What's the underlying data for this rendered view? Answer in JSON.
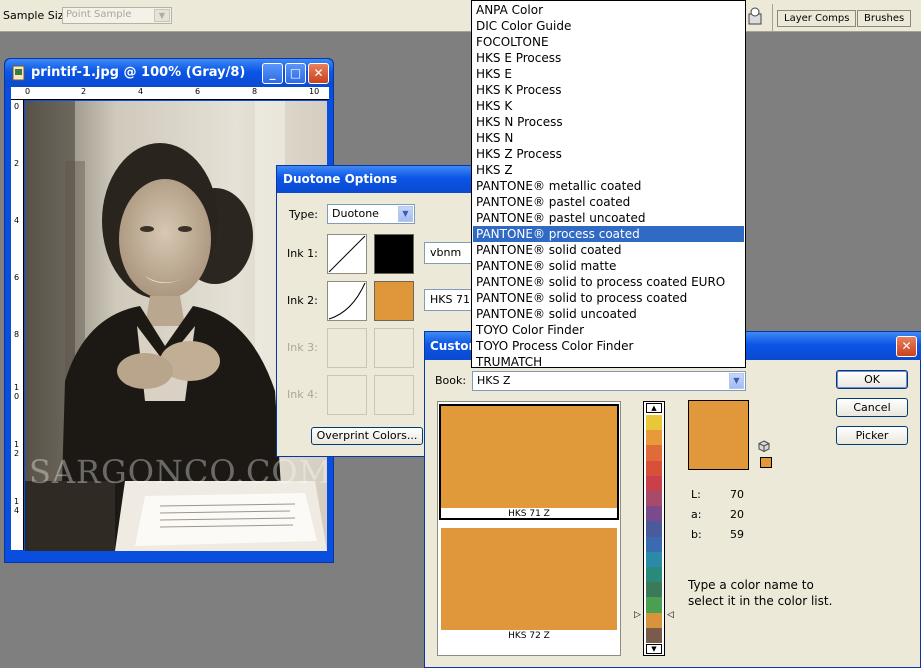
{
  "options_bar": {
    "sample_size_label": "Sample Size:",
    "sample_size_value": "Point Sample",
    "dock_tabs": [
      "Layer Comps",
      "Brushes"
    ]
  },
  "document": {
    "title": "printif-1.jpg @ 100% (Gray/8)",
    "ruler_top": [
      "0",
      "2",
      "4",
      "6",
      "8",
      "10"
    ],
    "ruler_left": [
      "0",
      "2",
      "4",
      "6",
      "8",
      "1 0",
      "1 2",
      "1 4"
    ],
    "watermark": "SARGONCO.COM"
  },
  "duotone": {
    "title": "Duotone Options",
    "type_label": "Type:",
    "type_value": "Duotone",
    "inks": [
      {
        "label": "Ink 1:",
        "name": "vbnm",
        "color": "#000000"
      },
      {
        "label": "Ink 2:",
        "name": "HKS 71",
        "color": "#e0973a"
      },
      {
        "label": "Ink 3:",
        "name": "",
        "color": ""
      },
      {
        "label": "Ink 4:",
        "name": "",
        "color": ""
      }
    ],
    "overprint_label": "Overprint Colors..."
  },
  "custom_colors": {
    "title": "Custom Colors",
    "book_label": "Book:",
    "book_value": "HKS Z",
    "buttons": {
      "ok": "OK",
      "cancel": "Cancel",
      "picker": "Picker"
    },
    "chips": [
      {
        "name": "HKS 71 Z",
        "color": "#e09a3a"
      },
      {
        "name": "HKS 72 Z",
        "color": "#e0973b"
      }
    ],
    "color_bar": [
      "#e8c83a",
      "#e89a3a",
      "#e06a3a",
      "#d8503a",
      "#c8404a",
      "#a84a6a",
      "#7a4a8a",
      "#4a5a9a",
      "#3a6ab0",
      "#2a8aa8",
      "#2a8a7a",
      "#3a7a5a",
      "#4aa050",
      "#d8943a",
      "#7a5a4a"
    ],
    "preview_color": "#e0983a",
    "lab": [
      {
        "label": "L:",
        "value": "70"
      },
      {
        "label": "a:",
        "value": "20"
      },
      {
        "label": "b:",
        "value": "59"
      }
    ],
    "hint": "Type a color name to select it in the color list."
  },
  "book_dropdown": {
    "options": [
      "ANPA Color",
      "DIC Color Guide",
      "FOCOLTONE",
      "HKS E Process",
      "HKS E",
      "HKS K Process",
      "HKS K",
      "HKS N Process",
      "HKS N",
      "HKS Z Process",
      "HKS Z",
      "PANTONE® metallic coated",
      "PANTONE® pastel coated",
      "PANTONE® pastel uncoated",
      "PANTONE® process coated",
      "PANTONE® solid coated",
      "PANTONE® solid matte",
      "PANTONE® solid to process coated EURO",
      "PANTONE® solid to process coated",
      "PANTONE® solid uncoated",
      "TOYO Color Finder",
      "TOYO Process Color Finder",
      "TRUMATCH"
    ],
    "selected": "PANTONE® process coated"
  }
}
